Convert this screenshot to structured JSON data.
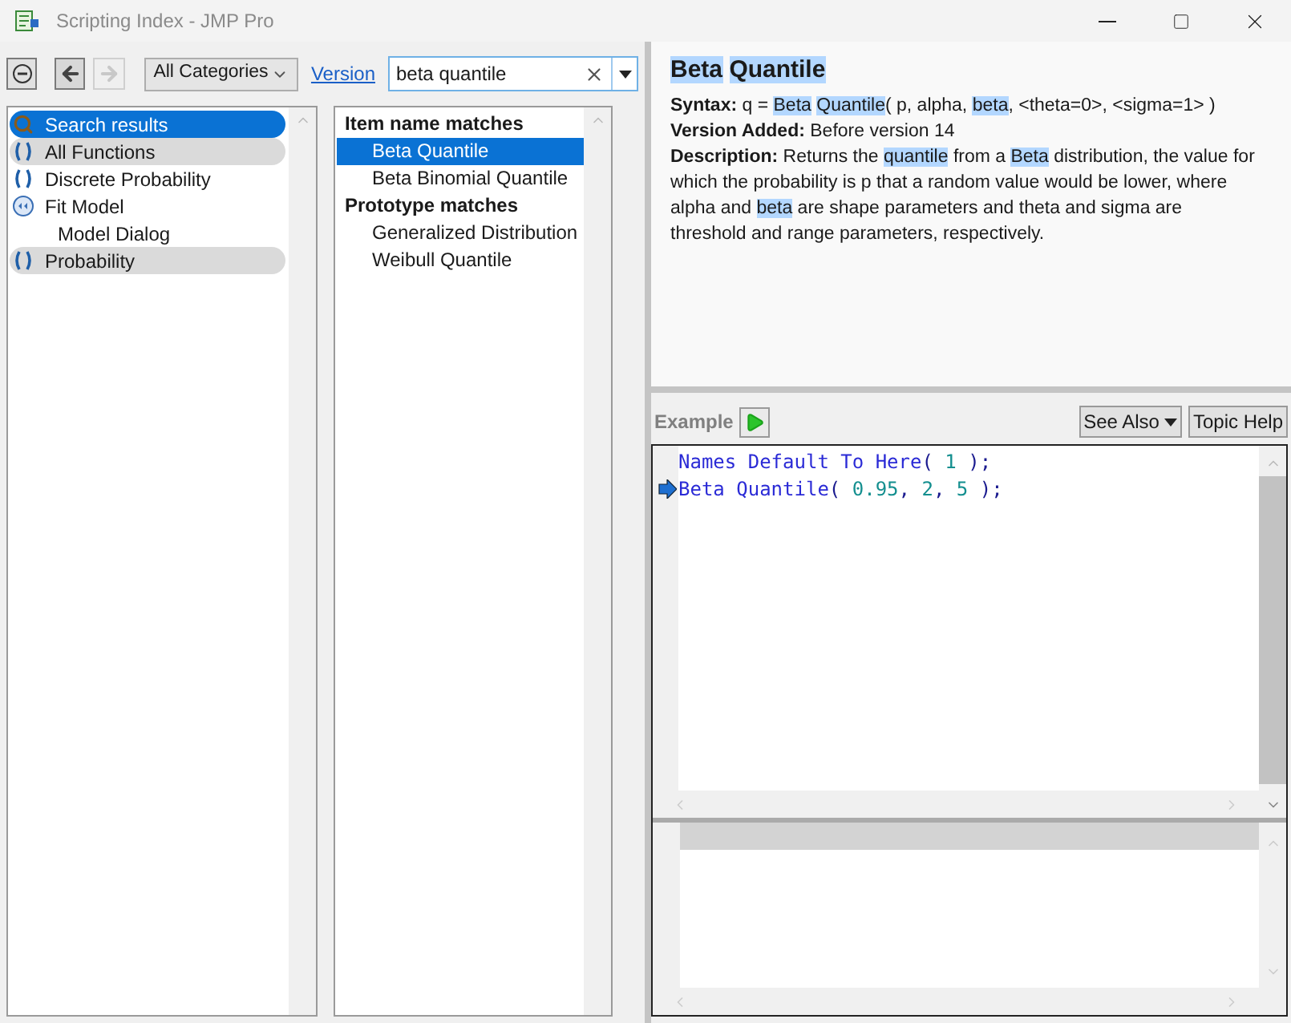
{
  "window": {
    "title": "Scripting Index - JMP Pro"
  },
  "toolbar": {
    "category": "All Categories",
    "version_link": "Version",
    "search": {
      "value": "beta quantile"
    }
  },
  "categories": [
    {
      "label": "Search results",
      "kind": "search",
      "selected": true,
      "highlighted": false
    },
    {
      "label": "All Functions",
      "kind": "parens",
      "selected": false,
      "highlighted": true
    },
    {
      "label": "Discrete Probability",
      "kind": "parens",
      "selected": false,
      "highlighted": false
    },
    {
      "label": "Fit Model",
      "kind": "platform",
      "selected": false,
      "highlighted": false,
      "children": [
        {
          "label": "Model Dialog",
          "selected": false,
          "highlighted": false
        }
      ]
    },
    {
      "label": "Probability",
      "kind": "parens",
      "selected": false,
      "highlighted": true
    }
  ],
  "results": [
    {
      "heading": "Item name matches",
      "items": [
        {
          "label": "Beta Quantile",
          "selected": true
        },
        {
          "label": "Beta Binomial Quantile",
          "selected": false
        }
      ]
    },
    {
      "heading": "Prototype matches",
      "items": [
        {
          "label": "Generalized Distribution",
          "selected": false
        },
        {
          "label": "Weibull Quantile",
          "selected": false
        }
      ]
    }
  ],
  "topic": {
    "title": [
      {
        "text": "Beta",
        "highlight": true
      },
      {
        "text": "Quantile",
        "highlight": true
      }
    ],
    "fields": [
      {
        "label": "Syntax:",
        "segments": [
          {
            "text": "q = ",
            "highlight": false
          },
          {
            "text": "Beta",
            "highlight": true
          },
          {
            "text": "Quantile",
            "highlight": true
          },
          {
            "text": "( p, alpha, ",
            "highlight": false
          },
          {
            "text": "beta",
            "highlight": true
          },
          {
            "text": ", <theta=0>, <sigma=1> )",
            "highlight": false
          }
        ]
      },
      {
        "label": "Version Added:",
        "segments": [
          {
            "text": "Before version 14",
            "highlight": false
          }
        ]
      },
      {
        "label": "Description:",
        "segments": [
          {
            "text": "Returns the ",
            "highlight": false
          },
          {
            "text": "quantile",
            "highlight": true
          },
          {
            "text": " from a ",
            "highlight": false
          },
          {
            "text": "Beta",
            "highlight": true
          },
          {
            "text": " distribution, the value for which the probability is p that a random value would be lower, where alpha and ",
            "highlight": false
          },
          {
            "text": "beta",
            "highlight": true
          },
          {
            "text": " are shape parameters and theta and sigma are threshold and range parameters, respectively.",
            "highlight": false
          }
        ]
      }
    ]
  },
  "example": {
    "label": "Example",
    "see_also": "See Also",
    "topic_help": "Topic Help",
    "code": [
      {
        "current": false,
        "tokens": [
          {
            "kind": "keyword",
            "text": "Names Default To Here"
          },
          {
            "kind": "punct",
            "text": "( "
          },
          {
            "kind": "number",
            "text": "1"
          },
          {
            "kind": "punct",
            "text": " );"
          }
        ]
      },
      {
        "current": true,
        "tokens": [
          {
            "kind": "keyword",
            "text": "Beta Quantile"
          },
          {
            "kind": "punct",
            "text": "( "
          },
          {
            "kind": "number",
            "text": "0.95"
          },
          {
            "kind": "punct",
            "text": ", "
          },
          {
            "kind": "number",
            "text": "2"
          },
          {
            "kind": "punct",
            "text": ", "
          },
          {
            "kind": "number",
            "text": "5"
          },
          {
            "kind": "punct",
            "text": " );"
          }
        ]
      }
    ]
  }
}
